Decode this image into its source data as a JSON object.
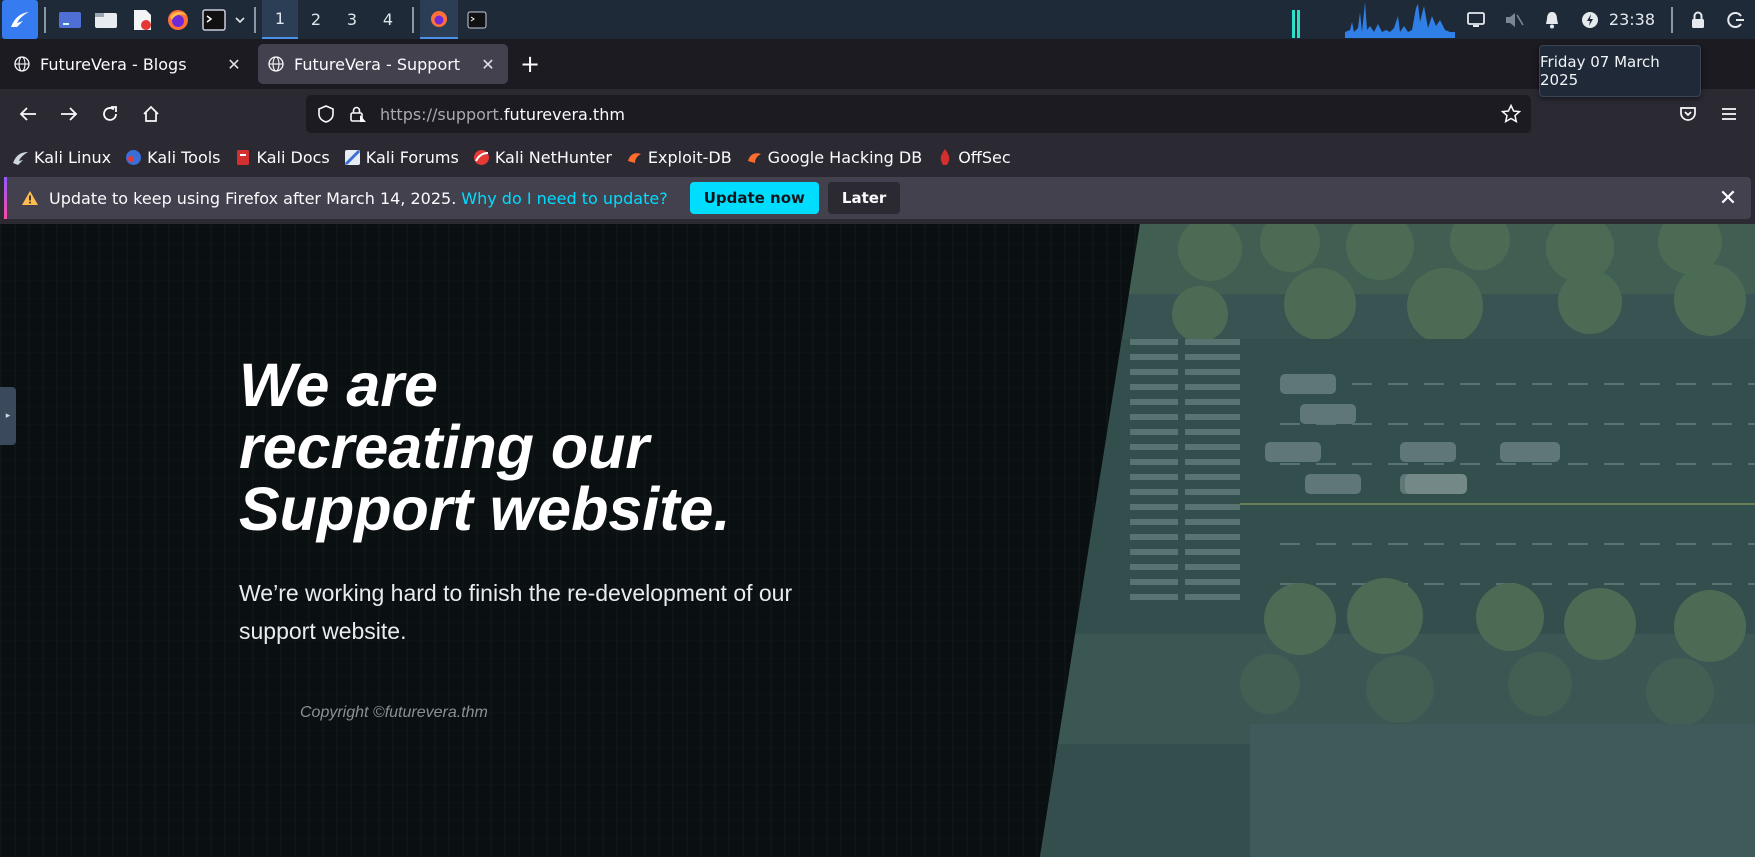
{
  "panel": {
    "workspaces": [
      "1",
      "2",
      "3",
      "4"
    ],
    "active_workspace": "1",
    "clock": "23:38",
    "date_tooltip": "Friday 07 March 2025",
    "accent": "#4c8fe6"
  },
  "browser": {
    "tabs": [
      {
        "title": "FutureVera - Blogs",
        "active": false
      },
      {
        "title": "FutureVera - Support",
        "active": true
      }
    ],
    "url_prefix": "https://support.",
    "url_host": "futurevera.thm",
    "bookmarks": [
      {
        "label": "Kali Linux",
        "icon": "kali-dragon-icon"
      },
      {
        "label": "Kali Tools",
        "icon": "kali-tools-icon"
      },
      {
        "label": "Kali Docs",
        "icon": "kali-docs-icon"
      },
      {
        "label": "Kali Forums",
        "icon": "kali-forums-icon"
      },
      {
        "label": "Kali NetHunter",
        "icon": "nethunter-icon"
      },
      {
        "label": "Exploit-DB",
        "icon": "exploit-db-icon"
      },
      {
        "label": "Google Hacking DB",
        "icon": "ghdb-icon"
      },
      {
        "label": "OffSec",
        "icon": "offsec-icon"
      }
    ],
    "notice": {
      "text": "Update to keep using Firefox after March 14, 2025.",
      "link": "Why do I need to update?",
      "primary_button": "Update now",
      "secondary_button": "Later",
      "accent": "#00ddff"
    }
  },
  "page": {
    "headline_line1": "We are",
    "headline_line2": "recreating our",
    "headline_line3": "Support website.",
    "subtext": "We’re working hard to finish the re-development of our support website.",
    "copyright": "Copyright ©futurevera.thm"
  }
}
